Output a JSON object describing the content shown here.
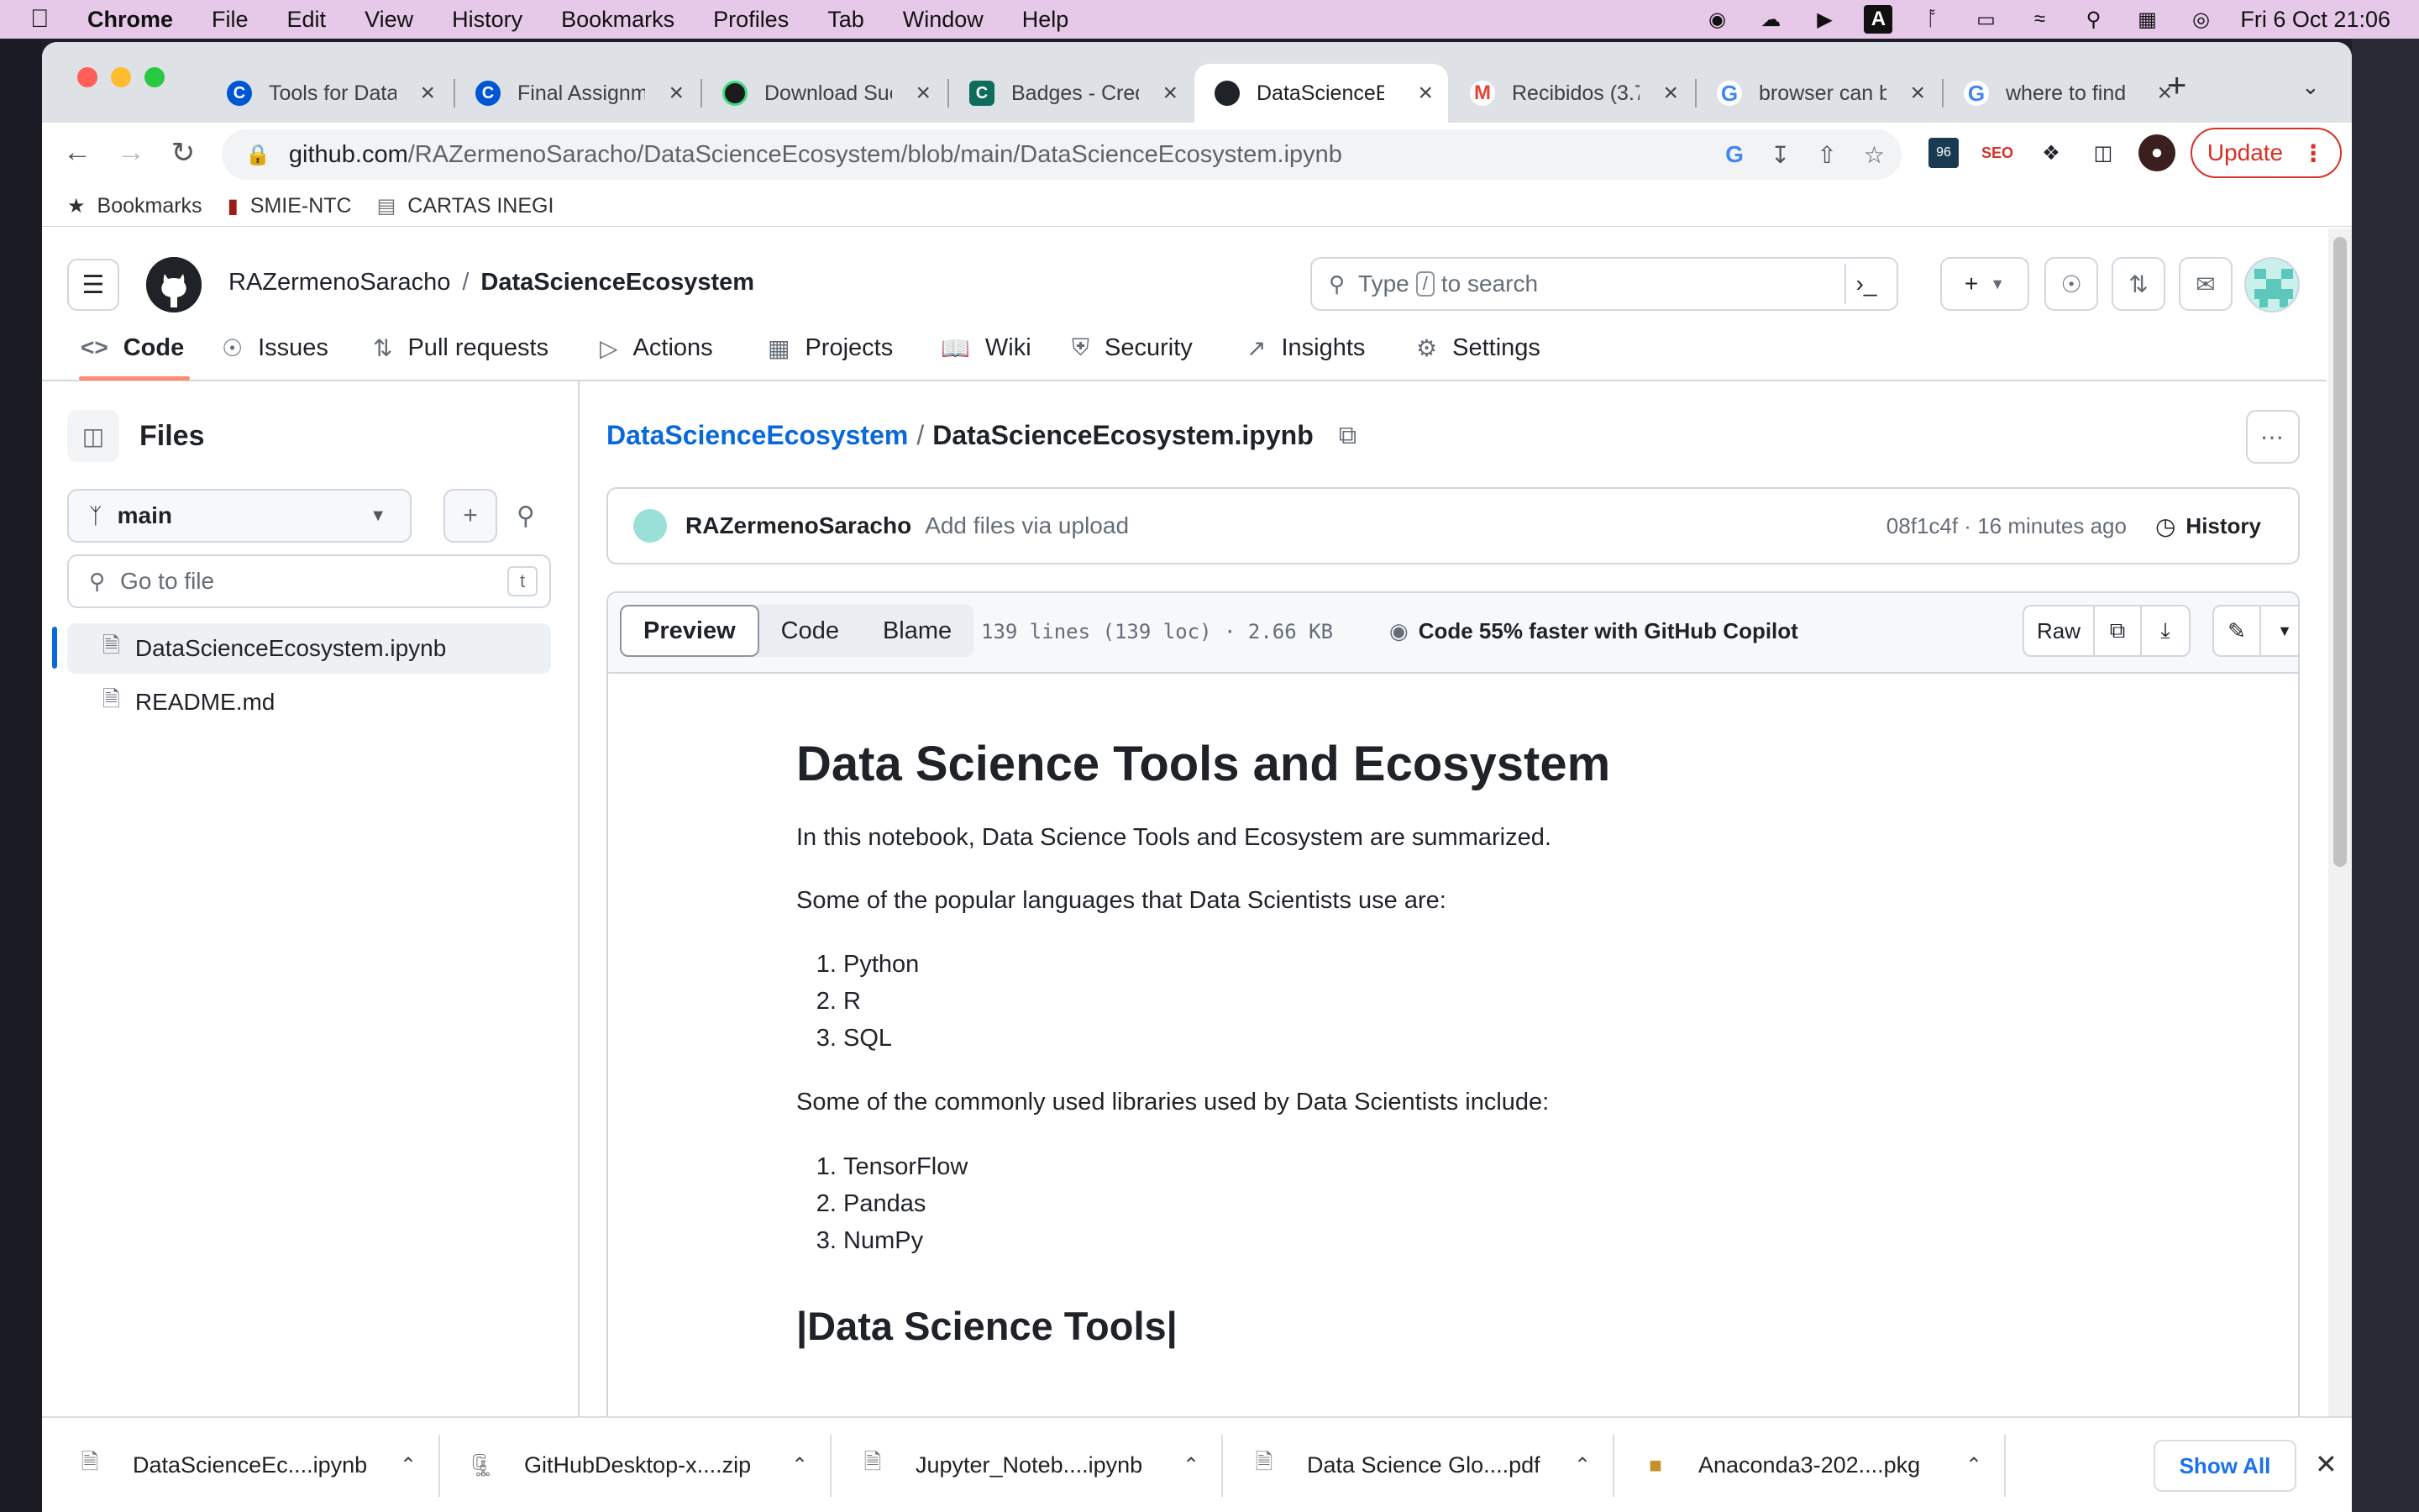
{
  "menubar": {
    "app": "Chrome",
    "items": [
      "File",
      "Edit",
      "View",
      "History",
      "Bookmarks",
      "Profiles",
      "Tab",
      "Window",
      "Help"
    ],
    "clock": "Fri 6 Oct  21:06"
  },
  "tabs": [
    {
      "title": "Tools for Data",
      "icon": "coursera-icon",
      "color": "#0056d2"
    },
    {
      "title": "Final Assignme",
      "icon": "coursera-icon",
      "color": "#0056d2"
    },
    {
      "title": "Download Suc",
      "icon": "download-success-icon",
      "color": "#1b1b1b"
    },
    {
      "title": "Badges - Cred",
      "icon": "credly-icon",
      "color": "#0f6b5c"
    },
    {
      "title": "DataScienceEc",
      "icon": "github-icon",
      "color": "#1f2328"
    },
    {
      "title": "Recibidos (3.7",
      "icon": "gmail-icon",
      "color": "#ea4335"
    },
    {
      "title": "browser can b",
      "icon": "google-icon",
      "color": "#4285f4"
    },
    {
      "title": "where to find",
      "icon": "google-icon",
      "color": "#4285f4"
    }
  ],
  "omnibox": {
    "host": "github.com",
    "path": "/RAZermenoSaracho/DataScienceEcosystem/blob/main/DataScienceEcosystem.ipynb"
  },
  "toolbar": {
    "update_label": "Update"
  },
  "bookmarks": [
    {
      "label": "Bookmarks",
      "icon": "star-icon"
    },
    {
      "label": "SMIE-NTC",
      "icon": "bookmark-favicon"
    },
    {
      "label": "CARTAS INEGI",
      "icon": "bookmark-favicon"
    }
  ],
  "gh": {
    "owner": "RAZermenoSaracho",
    "repo": "DataScienceEcosystem",
    "search_pre": "Type",
    "search_key": "/",
    "search_post": "to search",
    "nav": [
      "Code",
      "Issues",
      "Pull requests",
      "Actions",
      "Projects",
      "Wiki",
      "Security",
      "Insights",
      "Settings"
    ]
  },
  "sidebar": {
    "title": "Files",
    "branch": "main",
    "goto_placeholder": "Go to file",
    "goto_key": "t",
    "files": [
      "DataScienceEcosystem.ipynb",
      "README.md"
    ]
  },
  "file": {
    "repo": "DataScienceEcosystem",
    "name": "DataScienceEcosystem.ipynb",
    "commit_author": "RAZermenoSaracho",
    "commit_msg": "Add files via upload",
    "commit_meta": "08f1c4f · 16 minutes ago",
    "history": "History",
    "views": [
      "Preview",
      "Code",
      "Blame"
    ],
    "meta": "139 lines (139 loc) · 2.66 KB",
    "copilot": "Code 55% faster with GitHub Copilot",
    "raw": "Raw"
  },
  "notebook": {
    "title": "Data Science Tools and Ecosystem",
    "intro": "In this notebook, Data Science Tools and Ecosystem are summarized.",
    "languages_intro": "Some of the popular languages that Data Scientists use are:",
    "languages": [
      "Python",
      "R",
      "SQL"
    ],
    "libraries_intro": "Some of the commonly used libraries used by Data Scientists include:",
    "libraries": [
      "TensorFlow",
      "Pandas",
      "NumPy"
    ],
    "tools_heading": "|Data Science Tools|"
  },
  "downloads": [
    {
      "name": "DataScienceEc....ipynb",
      "icon": "file-icon"
    },
    {
      "name": "GitHubDesktop-x....zip",
      "icon": "zip-icon"
    },
    {
      "name": "Jupyter_Noteb....ipynb",
      "icon": "file-icon"
    },
    {
      "name": "Data Science Glo....pdf",
      "icon": "pdf-icon"
    },
    {
      "name": "Anaconda3-202....pkg",
      "icon": "package-icon"
    }
  ],
  "shelf": {
    "show_all": "Show All"
  }
}
